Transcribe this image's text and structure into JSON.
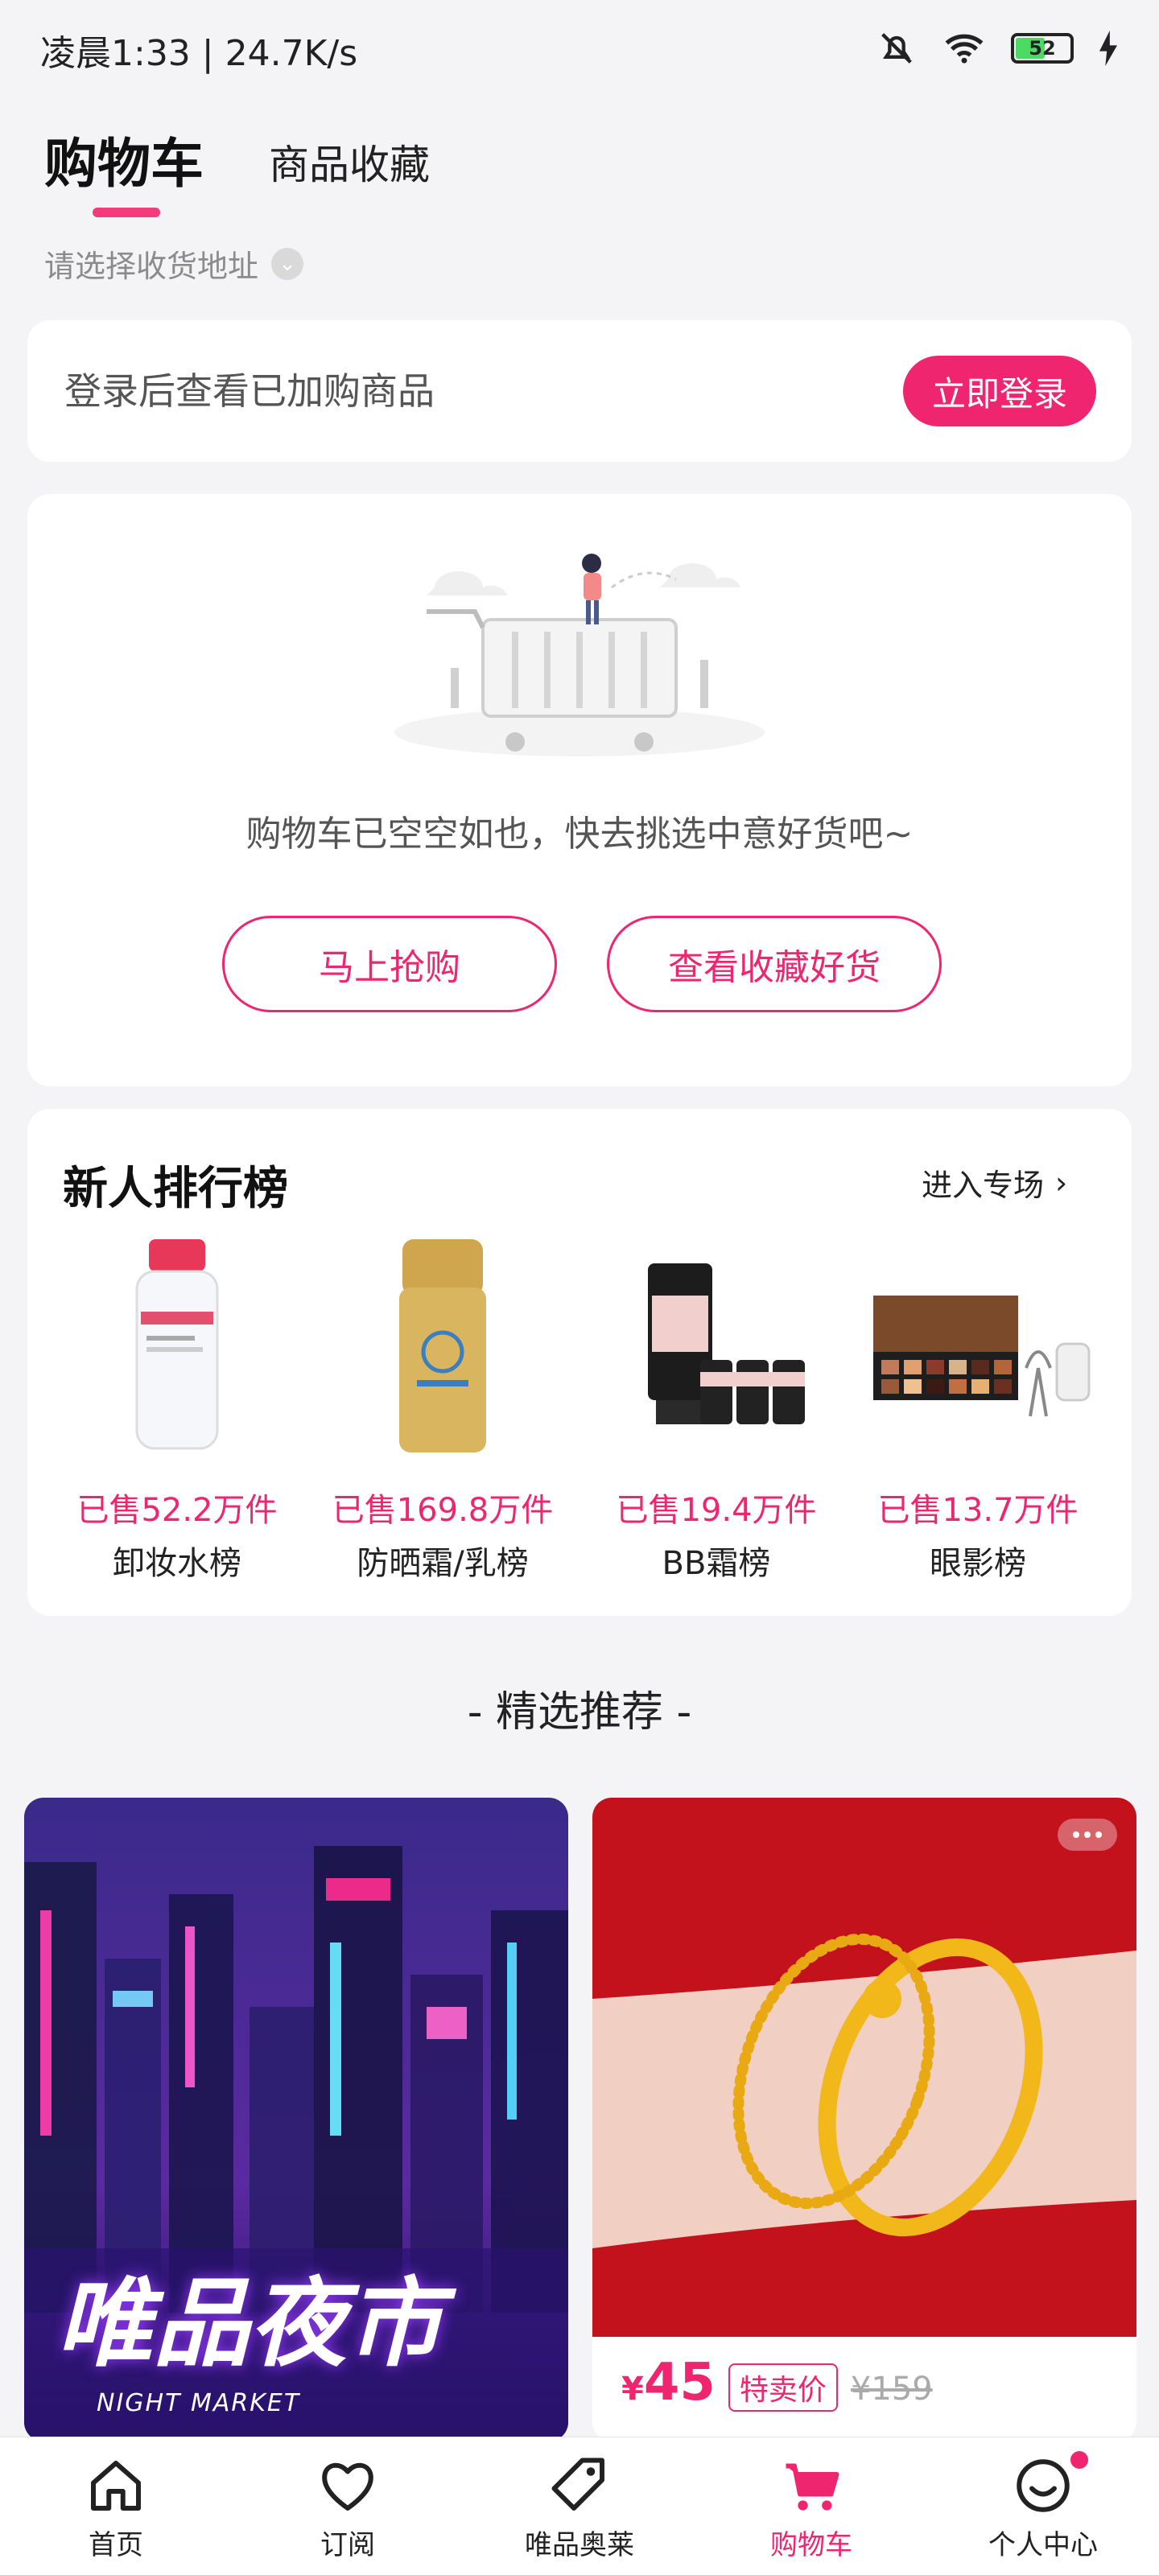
{
  "status": {
    "time": "凌晨1:33 | 24.7K/s",
    "battery": "52"
  },
  "header": {
    "tab_cart": "购物车",
    "tab_favorites": "商品收藏",
    "address_placeholder": "请选择收货地址"
  },
  "login": {
    "prompt": "登录后查看已加购商品",
    "button": "立即登录"
  },
  "empty_cart": {
    "message": "购物车已空空如也，快去挑选中意好货吧~",
    "buy_button": "马上抢购",
    "favorites_button": "查看收藏好货"
  },
  "ranking": {
    "title": "新人排行榜",
    "enter": "进入专场",
    "items": [
      {
        "sold": "已售52.2万件",
        "name": "卸妆水榜"
      },
      {
        "sold": "已售169.8万件",
        "name": "防晒霜/乳榜"
      },
      {
        "sold": "已售19.4万件",
        "name": "BB霜榜"
      },
      {
        "sold": "已售13.7万件",
        "name": "眼影榜"
      }
    ]
  },
  "recommend": {
    "title": "- 精选推荐 -",
    "night_market_title": "唯品夜市",
    "night_market_sub": "NIGHT MARKET",
    "product": {
      "currency": "¥",
      "price": "45",
      "tag": "特卖价",
      "original_price": "¥159"
    }
  },
  "bottom_nav": [
    {
      "label": "首页",
      "icon": "home-icon"
    },
    {
      "label": "订阅",
      "icon": "heart-icon"
    },
    {
      "label": "唯品奥莱",
      "icon": "tag-icon"
    },
    {
      "label": "购物车",
      "icon": "cart-icon"
    },
    {
      "label": "个人中心",
      "icon": "smile-icon"
    }
  ],
  "colors": {
    "accent": "#f0256f",
    "background": "#f4f4f6"
  }
}
